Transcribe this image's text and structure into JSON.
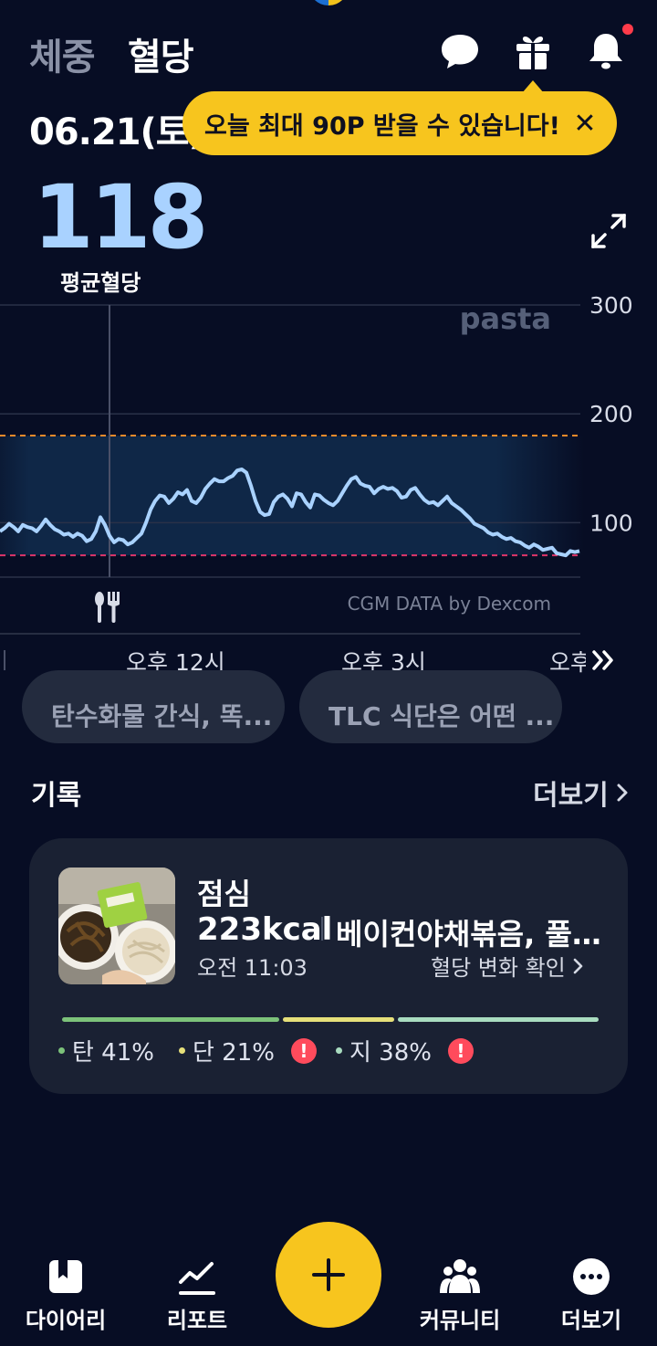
{
  "header": {
    "tabs": [
      {
        "label": "체중",
        "active": false
      },
      {
        "label": "혈당",
        "active": true
      }
    ],
    "icons": [
      "chat-icon",
      "gift-icon",
      "bell-icon"
    ],
    "has_notification": true
  },
  "date": "06.21(토)",
  "tooltip": {
    "text": "오늘 최대 90P 받을 수 있습니다!",
    "close": "✕"
  },
  "summary": {
    "average_value": "118",
    "average_label": "평균혈당"
  },
  "chart_data": {
    "type": "line",
    "y_ticks": [
      "300",
      "200",
      "100"
    ],
    "ylim": [
      50,
      300
    ],
    "target_range": {
      "low": 70,
      "high": 180
    },
    "watermark": "pasta",
    "source_label": "CGM DATA by Dexcom",
    "x_labels": [
      "오후 12시",
      "오후 3시",
      "오후"
    ],
    "meal_marker": "meal-icon",
    "series": [
      {
        "x": [
          0,
          5,
          10,
          15,
          20,
          25,
          30,
          35,
          40,
          45,
          50,
          55,
          60,
          65,
          70,
          75,
          80,
          85,
          90,
          95,
          100,
          105,
          110,
          115,
          120,
          125,
          130,
          135,
          140,
          145,
          150,
          155,
          160,
          165,
          170,
          175,
          180,
          185,
          190,
          195,
          200,
          205,
          210,
          215,
          220,
          225,
          230,
          235,
          240,
          245,
          250,
          255,
          260,
          265,
          270,
          275,
          280,
          285,
          290,
          295,
          300,
          305,
          310,
          315,
          320,
          325,
          330,
          335,
          340,
          345,
          350,
          355,
          360,
          365,
          370,
          375,
          380,
          385,
          390,
          395,
          400,
          405,
          410,
          415,
          420,
          425,
          430,
          435,
          440,
          445,
          450,
          455,
          460,
          465,
          470,
          475,
          480,
          485,
          490,
          495,
          500,
          505,
          510,
          515,
          520,
          525,
          530,
          535,
          540,
          545,
          550,
          555,
          560,
          565,
          570,
          575,
          580,
          585,
          590,
          595,
          600,
          605,
          610,
          615,
          620,
          625,
          630,
          635
        ],
        "values": [
          92,
          95,
          99,
          96,
          92,
          98,
          96,
          95,
          92,
          97,
          103,
          98,
          94,
          92,
          89,
          90,
          87,
          90,
          88,
          83,
          85,
          92,
          105,
          98,
          88,
          82,
          85,
          84,
          80,
          82,
          86,
          90,
          100,
          112,
          120,
          125,
          124,
          118,
          122,
          128,
          126,
          130,
          120,
          118,
          123,
          131,
          136,
          140,
          138,
          138,
          141,
          143,
          148,
          149,
          146,
          134,
          120,
          110,
          107,
          108,
          119,
          124,
          126,
          122,
          115,
          127,
          126,
          119,
          114,
          126,
          125,
          121,
          118,
          116,
          120,
          127,
          134,
          140,
          142,
          136,
          134,
          133,
          127,
          131,
          133,
          131,
          132,
          129,
          123,
          124,
          130,
          132,
          126,
          121,
          118,
          119,
          116,
          120,
          124,
          118,
          115,
          112,
          108,
          104,
          99,
          97,
          95,
          91,
          89,
          90,
          87,
          85,
          86,
          83,
          82,
          79,
          77,
          80,
          78,
          75,
          76,
          77,
          72,
          71,
          70,
          74,
          73,
          74
        ]
      }
    ]
  },
  "articles": [
    {
      "title": "탄수화물 간식, 똑..."
    },
    {
      "title": "TLC 식단은 어떤 ..."
    }
  ],
  "records": {
    "title": "기록",
    "more": "더보기",
    "meal": {
      "type": "점심",
      "kcal": "223kcal",
      "foods": "베이컨야채볶음, 풀...",
      "time": "오전 11:03",
      "check_label": "혈당 변화 확인",
      "macros": [
        {
          "label": "탄 41%",
          "percent": 41,
          "color": "#7cc27a",
          "warning": false
        },
        {
          "label": "단 21%",
          "percent": 21,
          "color": "#e6e07a",
          "warning": true
        },
        {
          "label": "지 38%",
          "percent": 38,
          "color": "#a9dcc0",
          "warning": true
        }
      ]
    }
  },
  "nav": {
    "items": [
      {
        "label": "다이어리",
        "icon": "diary-icon"
      },
      {
        "label": "리포트",
        "icon": "report-icon"
      },
      {
        "label": "커뮤니티",
        "icon": "community-icon"
      },
      {
        "label": "더보기",
        "icon": "more-icon"
      }
    ],
    "fab_icon": "plus-icon"
  },
  "colors": {
    "background": "#070d24",
    "accent_yellow": "#f7c51e",
    "glucose_line": "#a9d2ff",
    "high_threshold": "#f28a2a",
    "low_threshold": "#e0356a"
  }
}
